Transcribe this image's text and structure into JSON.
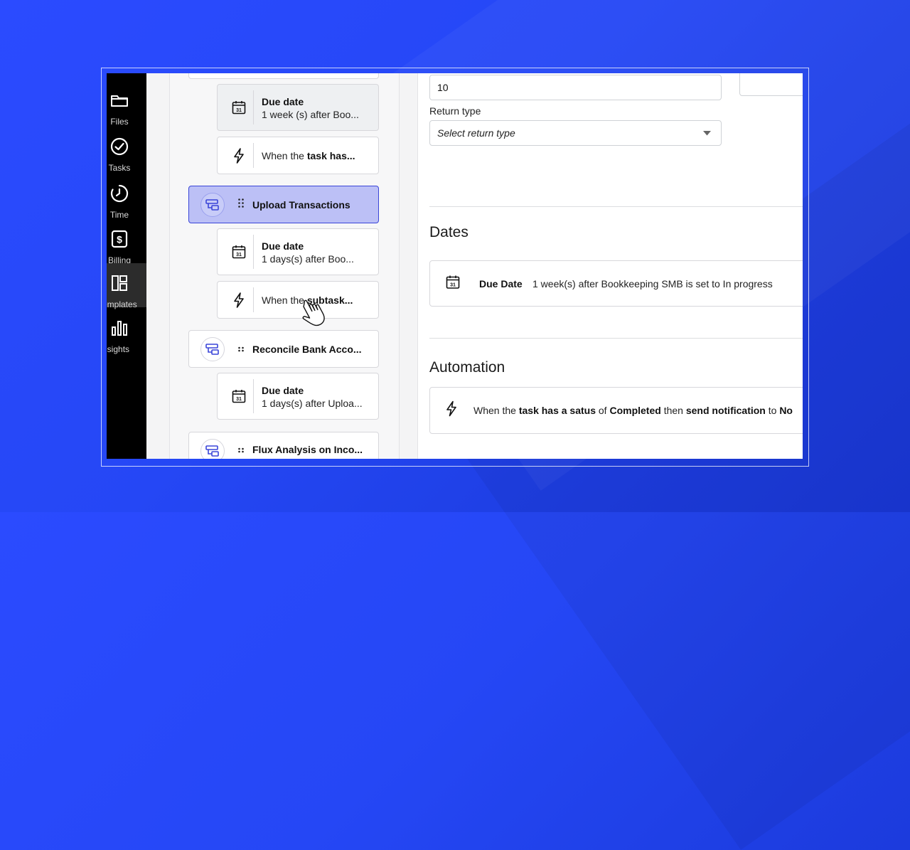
{
  "nav": {
    "items": [
      {
        "label": "Files",
        "icon": "folder-icon"
      },
      {
        "label": "Tasks",
        "icon": "check-circle-icon"
      },
      {
        "label": "Time",
        "icon": "timer-icon"
      },
      {
        "label": "Billing",
        "icon": "dollar-icon"
      },
      {
        "label": "emplates",
        "icon": "templates-icon"
      },
      {
        "label": "nsights",
        "icon": "bar-chart-icon"
      }
    ]
  },
  "list": {
    "card1": {
      "title": "Due date",
      "subtitle": "1 week (s) after Boo..."
    },
    "card2": {
      "prefix": "When the ",
      "bold": "task has..."
    },
    "task1": {
      "name": "Upload Transactions"
    },
    "card3": {
      "title": "Due date",
      "subtitle": "1 days(s) after Boo..."
    },
    "card4": {
      "prefix": "When the ",
      "bold": "subtask..."
    },
    "task2": {
      "name": "Reconcile Bank Acco..."
    },
    "card5": {
      "title": "Due date",
      "subtitle": "1 days(s) after Uploa..."
    },
    "task3": {
      "name": "Flux Analysis on Inco..."
    }
  },
  "form": {
    "number_value": "10",
    "return_type_label": "Return type",
    "return_type_placeholder": "Select return type"
  },
  "dates": {
    "heading": "Dates",
    "due_label": "Due Date",
    "due_value": "1 week(s) after Bookkeeping SMB is set to In progress"
  },
  "automation": {
    "heading": "Automation",
    "t1": "When the ",
    "b1": "task has a satus",
    "t2": " of ",
    "b2": "Completed",
    "t3": " then ",
    "b3": "send notification",
    "t4": " to ",
    "b4": "No"
  },
  "colors": {
    "accent": "#3a45d8",
    "selected_bg": "#bcc0f6",
    "background": "#2547f5"
  }
}
